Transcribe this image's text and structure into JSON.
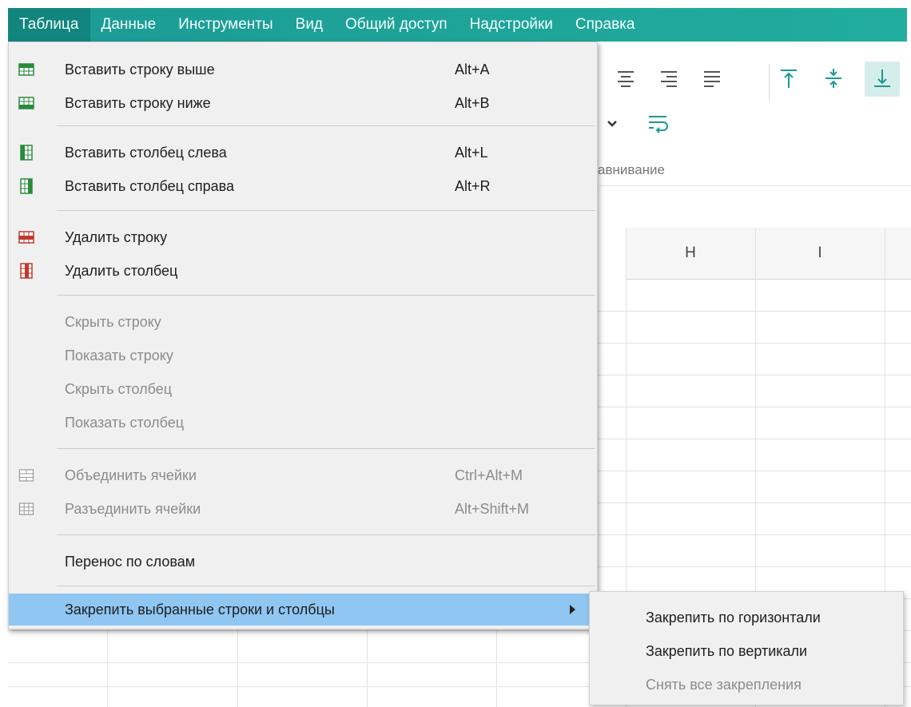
{
  "menubar": {
    "items": [
      {
        "label": "Таблица"
      },
      {
        "label": "Данные"
      },
      {
        "label": "Инструменты"
      },
      {
        "label": "Вид"
      },
      {
        "label": "Общий доступ"
      },
      {
        "label": "Надстройки"
      },
      {
        "label": "Справка"
      }
    ],
    "active": "Таблица",
    "accent": "#1fa39b"
  },
  "toolbar": {
    "group_label": "авнивание",
    "icons": [
      "align-center-icon",
      "align-right-icon",
      "align-justify-icon",
      "align-top-icon",
      "align-middle-icon",
      "align-bottom-icon",
      "chevron-down-icon",
      "wrap-text-icon"
    ]
  },
  "sheet": {
    "columns": [
      "H",
      "I"
    ]
  },
  "dropdown": {
    "items": [
      {
        "label": "Вставить строку выше",
        "shortcut": "Alt+A",
        "icon": "insert-row-above-icon"
      },
      {
        "label": "Вставить строку ниже",
        "shortcut": "Alt+B",
        "icon": "insert-row-below-icon"
      },
      {
        "label": "Вставить столбец слева",
        "shortcut": "Alt+L",
        "icon": "insert-column-left-icon"
      },
      {
        "label": "Вставить столбец справа",
        "shortcut": "Alt+R",
        "icon": "insert-column-right-icon"
      },
      {
        "label": "Удалить строку",
        "shortcut": "",
        "icon": "delete-row-icon"
      },
      {
        "label": "Удалить столбец",
        "shortcut": "",
        "icon": "delete-column-icon"
      },
      {
        "label": "Скрыть строку",
        "shortcut": "",
        "icon": ""
      },
      {
        "label": "Показать строку",
        "shortcut": "",
        "icon": ""
      },
      {
        "label": "Скрыть столбец",
        "shortcut": "",
        "icon": ""
      },
      {
        "label": "Показать столбец",
        "shortcut": "",
        "icon": ""
      },
      {
        "label": "Объединить ячейки",
        "shortcut": "Ctrl+Alt+M",
        "icon": "merge-cells-icon"
      },
      {
        "label": "Разъединить ячейки",
        "shortcut": "Alt+Shift+M",
        "icon": "unmerge-cells-icon"
      },
      {
        "label": "Перенос по словам",
        "shortcut": "",
        "icon": ""
      },
      {
        "label": "Закрепить выбранные строки и столбцы",
        "shortcut": "",
        "icon": "",
        "highlight_color": "#8fc6f2"
      }
    ]
  },
  "submenu": {
    "items": [
      {
        "label": "Закрепить по горизонтали"
      },
      {
        "label": "Закрепить по вертикали"
      },
      {
        "label": "Снять все закрепления"
      }
    ]
  }
}
